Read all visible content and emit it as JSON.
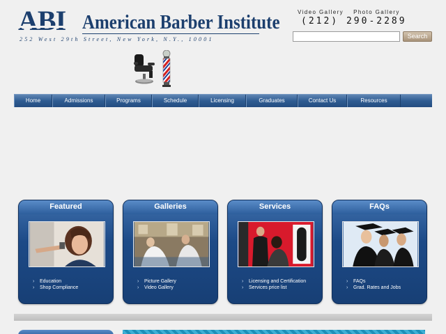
{
  "header": {
    "logo_letters": "ABI",
    "logo_name": "American Barber Institute",
    "address": "252 West 29th Street, New York, N.Y., 10001"
  },
  "top_links": {
    "video_gallery": "Video Gallery",
    "photo_gallery": "Photo Gallery"
  },
  "phone": "(212) 290-2289",
  "search": {
    "value": "",
    "button_label": "Search"
  },
  "nav": {
    "items": [
      "Home",
      "Admissions",
      "Programs",
      "Schedule",
      "Licensing",
      "Graduates",
      "Contact Us",
      "Resources"
    ]
  },
  "boxes": [
    {
      "title": "Featured",
      "links": [
        "Education",
        "Shop Compliance"
      ]
    },
    {
      "title": "Galleries",
      "links": [
        "Picture Gallery",
        "Video Gallery"
      ]
    },
    {
      "title": "Services",
      "links": [
        "Licensing and Certification",
        "Services price list"
      ]
    },
    {
      "title": "FAQs",
      "links": [
        "FAQs",
        "Grad. Rates and Jobs"
      ]
    }
  ],
  "colors": {
    "brand_navy": "#1c3f6e",
    "nav_blue": "#2f5c92",
    "box_blue": "#1d4a87",
    "search_button": "#a8937a",
    "page_bg": "#f0f0f0"
  }
}
